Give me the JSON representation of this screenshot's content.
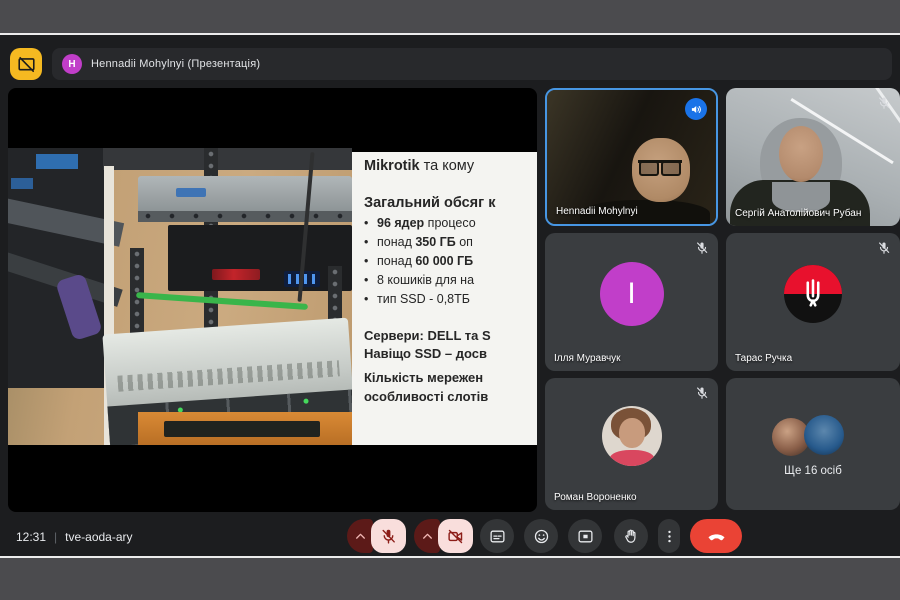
{
  "colors": {
    "accent_blue": "#1a73e8",
    "active_speaker_border": "#4796e3",
    "presentation_yellow": "#f5b921",
    "avatar_purple": "#c13ec9",
    "end_call_red": "#ea4335",
    "muted_bg_pink": "#f9dedc",
    "muted_icon_red": "#8c1d18",
    "control_bg": "#333537",
    "flag_red": "#e8112d"
  },
  "top_bar": {
    "presentation_button_icon": "presentation-paused-icon",
    "presenter_avatar_letter": "H",
    "presenter_label": "Hennadii Mohylnyi (Презентація)"
  },
  "slide": {
    "title_bold": "Mikrotik",
    "title_rest": " та кому",
    "heading": "Загальний обсяг к",
    "bullets": [
      {
        "pre": "",
        "bold": "96 ядер",
        "post": " процесо"
      },
      {
        "pre": "понад ",
        "bold": "350 ГБ",
        "post": " оп"
      },
      {
        "pre": "понад ",
        "bold": "60 000 ГБ",
        "post": ""
      },
      {
        "pre": "8 кошиків для на",
        "bold": "",
        "post": ""
      },
      {
        "pre": "тип SSD - 0,8ТБ",
        "bold": "",
        "post": ""
      }
    ],
    "footer": [
      "Сервери: DELL та S",
      "Навіщо SSD – досв",
      "Кількість мережен",
      "особливості слотів"
    ]
  },
  "participants": [
    {
      "name": "Hennadii Mohylnyi",
      "status_icon": "speaker-on-icon",
      "active_speaker": true
    },
    {
      "name": "Сергій Анатолійович Рубан",
      "status_icon": "mic-off-icon"
    },
    {
      "name": "Ілля Муравчук",
      "avatar_letter": "I",
      "status_icon": "mic-off-icon"
    },
    {
      "name": "Тарас Ручка",
      "status_icon": "mic-off-icon"
    },
    {
      "name": "Роман Вороненко",
      "status_icon": "mic-off-icon"
    },
    {
      "name": "Ще 16 осіб",
      "overflow_tile": true
    }
  ],
  "bottom_bar": {
    "time": "12:31",
    "separator": "|",
    "meeting_code": "tve-aoda-ary",
    "controls": [
      {
        "icon": "chevron-up-icon",
        "group": "microphone"
      },
      {
        "icon": "mic-off-icon",
        "group": "microphone",
        "state": "muted"
      },
      {
        "icon": "chevron-up-icon",
        "group": "camera"
      },
      {
        "icon": "camera-off-icon",
        "group": "camera",
        "state": "off"
      },
      {
        "icon": "captions-icon"
      },
      {
        "icon": "reactions-icon"
      },
      {
        "icon": "present-screen-icon"
      },
      {
        "icon": "raise-hand-icon"
      },
      {
        "icon": "more-options-icon"
      },
      {
        "icon": "end-call-icon"
      }
    ]
  }
}
